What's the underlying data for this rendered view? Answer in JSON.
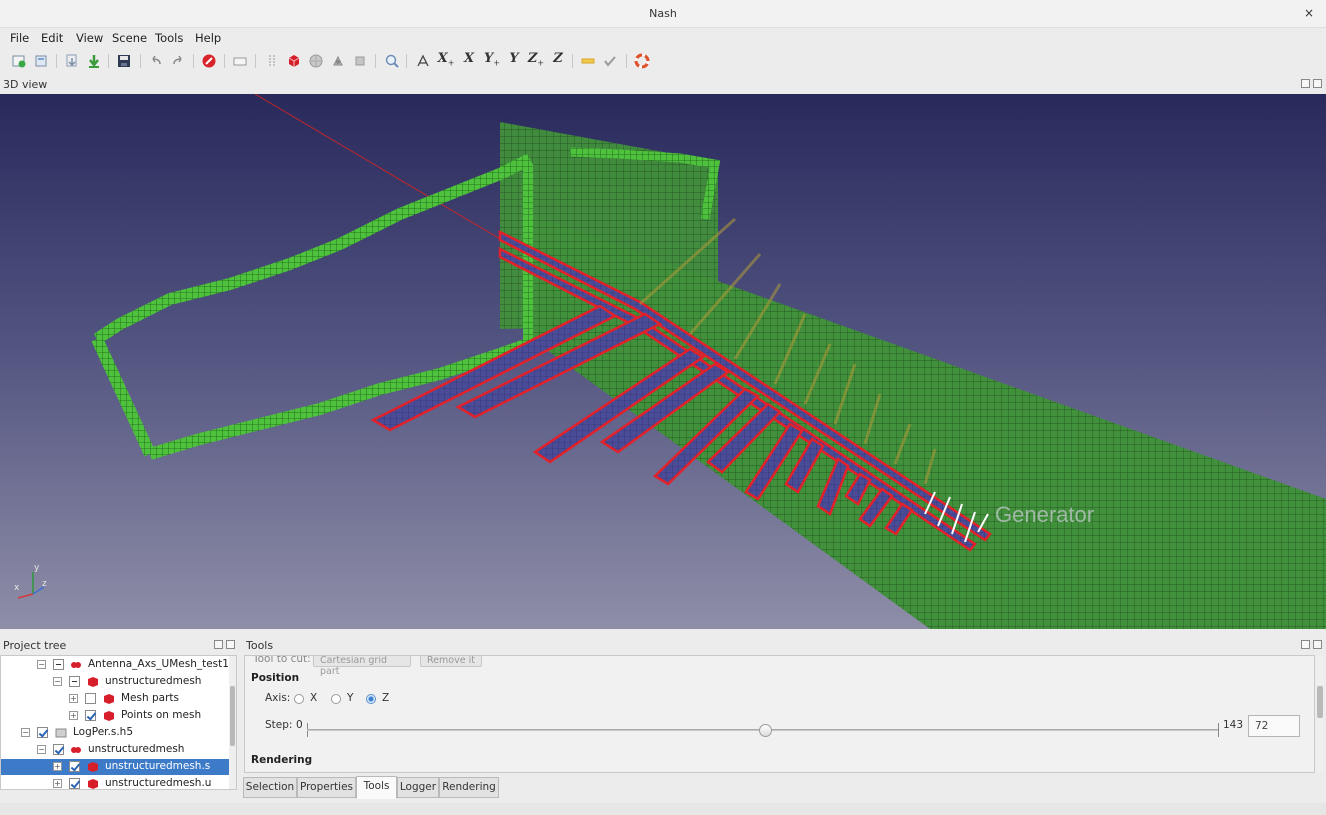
{
  "window": {
    "title": "Nash",
    "close_icon": "×"
  },
  "menu": [
    {
      "label": "File"
    },
    {
      "label": "Edit"
    },
    {
      "label": "View"
    },
    {
      "label": "Scene"
    },
    {
      "label": "Tools"
    },
    {
      "label": "Help"
    }
  ],
  "toolbar": {
    "axis_buttons": [
      {
        "label": "X",
        "sub": "+"
      },
      {
        "label": "X",
        "sub": ""
      },
      {
        "label": "Y",
        "sub": "+"
      },
      {
        "label": "Y",
        "sub": ""
      },
      {
        "label": "Z",
        "sub": "+"
      },
      {
        "label": "Z",
        "sub": ""
      }
    ]
  },
  "view3d": {
    "dock_title": "3D view",
    "overlay_label": "Generator",
    "axes": {
      "x": "x",
      "y": "y",
      "z": "z"
    },
    "colors": {
      "mesh_green": "#46b83c",
      "plane_green": "#3f8f3a",
      "strip_blue": "#4d4f9e",
      "outline_red": "#e2212a"
    }
  },
  "project_tree": {
    "dock_title": "Project tree",
    "items": [
      {
        "label": "Antenna_Axs_UMesh_test1",
        "icon": "antenna-icon"
      },
      {
        "label": "unstructuredmesh",
        "icon": "mesh-icon"
      },
      {
        "label": "Mesh parts",
        "icon": "mesh-parts-icon"
      },
      {
        "label": "Points on mesh",
        "icon": "points-icon"
      },
      {
        "label": "LogPer.s.h5",
        "icon": "file-icon"
      },
      {
        "label": "unstructuredmesh",
        "icon": "antenna-icon"
      },
      {
        "label": "unstructuredmesh.s",
        "icon": "mesh-icon"
      },
      {
        "label": "unstructuredmesh.u",
        "icon": "mesh-icon"
      }
    ]
  },
  "tools": {
    "dock_title": "Tools",
    "cut_row": {
      "label": "Tool to cut:",
      "select_value": "Cartesian grid part",
      "button_label": "Remove it"
    },
    "position": {
      "title": "Position",
      "axis_label": "Axis:",
      "options": [
        "X",
        "Y",
        "Z"
      ],
      "selected": "Z",
      "step_label": "Step:",
      "min": "0",
      "max": "143",
      "value": "72",
      "fraction": 0.503
    },
    "rendering": {
      "title": "Rendering"
    },
    "tabs": [
      {
        "label": "Selection"
      },
      {
        "label": "Properties"
      },
      {
        "label": "Tools"
      },
      {
        "label": "Logger"
      },
      {
        "label": "Rendering"
      }
    ],
    "active_tab": "Tools"
  }
}
